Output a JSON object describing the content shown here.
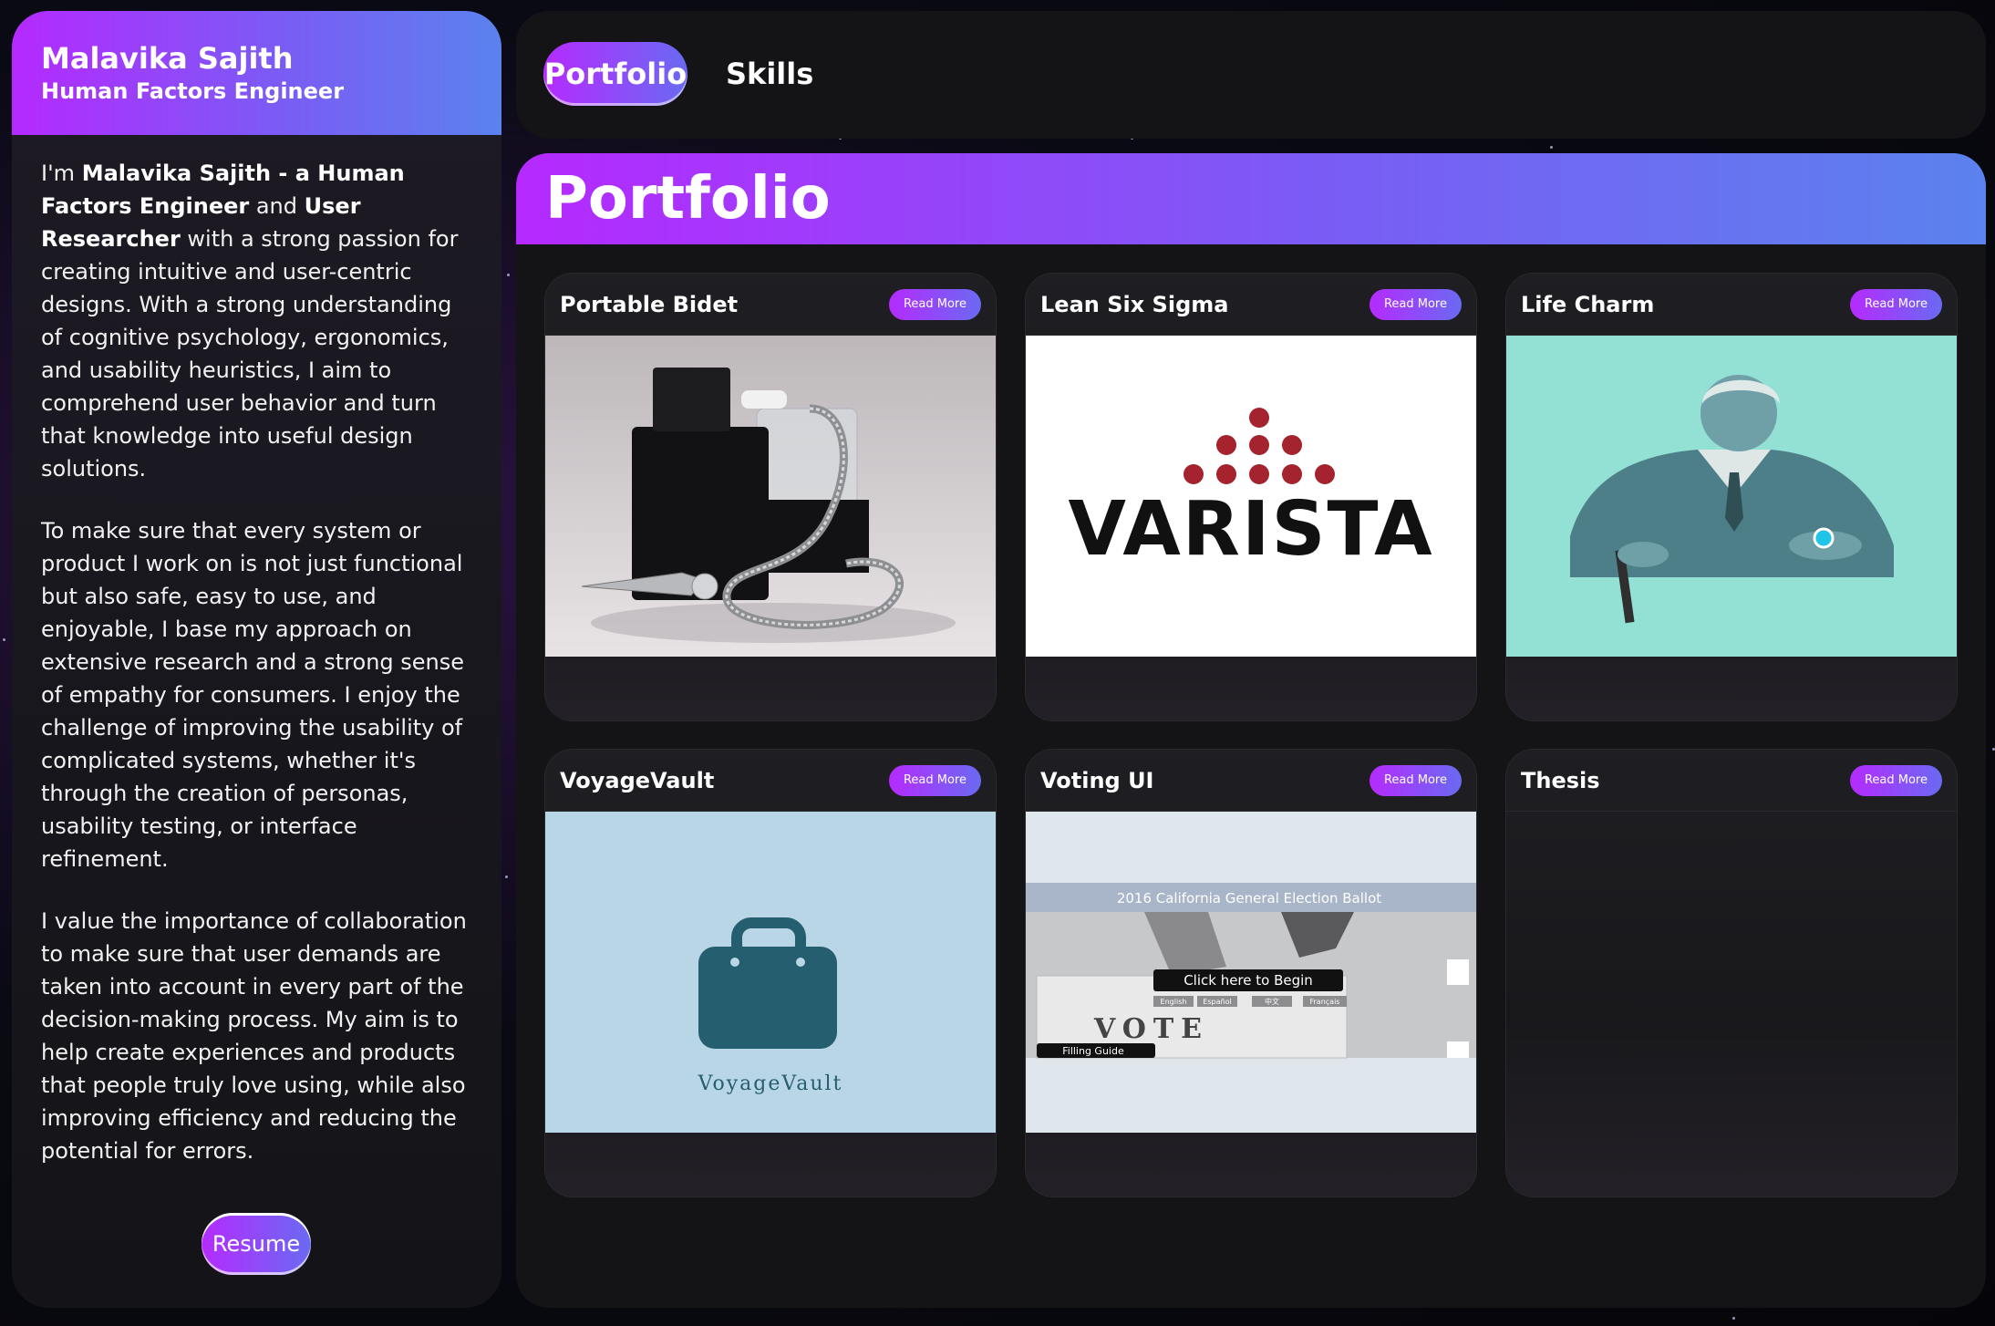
{
  "sidebar": {
    "name": "Malavika Sajith",
    "role": "Human Factors Engineer",
    "intro": {
      "im": "I'm ",
      "name_title": "Malavika Sajith - a Human Factors Engineer",
      "and": " and ",
      "researcher": "User Researcher",
      "rest": " with a strong passion for creating intuitive and user-centric designs. With a strong understanding of cognitive psychology, ergonomics, and usability heuristics, I aim to comprehend user behavior and turn that knowledge into useful design solutions."
    },
    "paragraph2": "To make sure that every system or product I work on is not just functional but also safe, easy to use, and enjoyable, I base my approach on extensive research and a strong sense of empathy for consumers. I enjoy the challenge of improving the usability of complicated systems, whether it's through the creation of personas, usability testing, or interface refinement.",
    "paragraph3": "I value the importance of collaboration to make sure that user demands are taken into account in every part of the decision-making process. My aim is to help create experiences and products that people truly love using, while also improving efficiency and reducing the potential for errors.",
    "resume_label": "Resume"
  },
  "tabs": [
    {
      "label": "Portfolio",
      "active": true
    },
    {
      "label": "Skills",
      "active": false
    }
  ],
  "main": {
    "title": "Portfolio",
    "read_more": "Read More",
    "cards": [
      {
        "title": "Portable Bidet"
      },
      {
        "title": "Lean Six Sigma",
        "image_text": "VARISTA"
      },
      {
        "title": "Life Charm"
      },
      {
        "title": "VoyageVault",
        "image_text": "VoyageVault"
      },
      {
        "title": "Voting UI",
        "ballot_header": "2016 California General Election Ballot",
        "begin": "Click here to Begin",
        "languages": [
          "English",
          "Español",
          "中文",
          "Français"
        ],
        "vote": "VOTE",
        "guide": "Filling Guide"
      },
      {
        "title": "Thesis"
      }
    ]
  },
  "colors": {
    "accent_start": "#b529ff",
    "accent_end": "#5b82ee",
    "panel": "#141416"
  }
}
